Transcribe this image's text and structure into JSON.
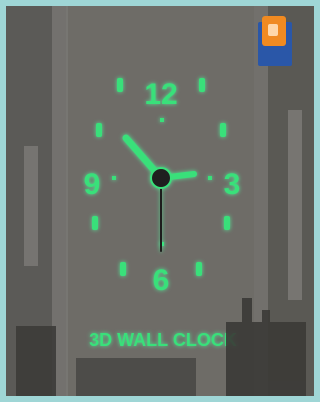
{
  "product": {
    "caption": "3D WALL CLOCK",
    "numerals": {
      "top": "12",
      "right": "3",
      "bottom": "6",
      "left": "9"
    },
    "glow_color": "#39e07a"
  },
  "icons": {
    "brand_badge": "brand-badge-icon"
  },
  "colors": {
    "frame": "#9fd6d6",
    "wall": "#6e6c67",
    "badge_orange": "#f08a21",
    "badge_blue": "#2a57a8"
  }
}
